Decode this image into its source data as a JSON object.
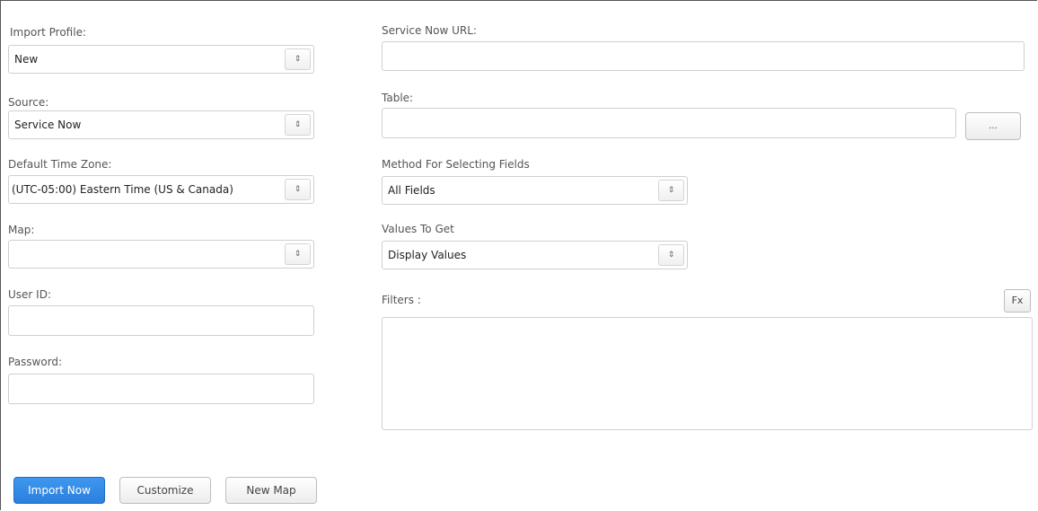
{
  "left": {
    "import_profile": {
      "label": "Import Profile:",
      "value": "New"
    },
    "source": {
      "label": "Source:",
      "value": "Service Now"
    },
    "time_zone": {
      "label": "Default Time Zone:",
      "value": "(UTC-05:00) Eastern Time (US & Canada)"
    },
    "map": {
      "label": "Map:",
      "value": ""
    },
    "user_id": {
      "label": "User ID:",
      "value": ""
    },
    "password": {
      "label": "Password:",
      "value": ""
    }
  },
  "right": {
    "url": {
      "label": "Service Now URL:",
      "value": ""
    },
    "table": {
      "label": "Table:",
      "value": "",
      "browse_label": "..."
    },
    "method": {
      "label": "Method For Selecting Fields",
      "value": "All Fields"
    },
    "values": {
      "label": "Values To Get",
      "value": "Display Values"
    },
    "filters": {
      "label": "Filters :",
      "fx_label": "Fx",
      "value": ""
    }
  },
  "actions": {
    "import_now": "Import Now",
    "customize": "Customize",
    "new_map": "New Map"
  },
  "icons": {
    "select_arrow": "⇕"
  }
}
